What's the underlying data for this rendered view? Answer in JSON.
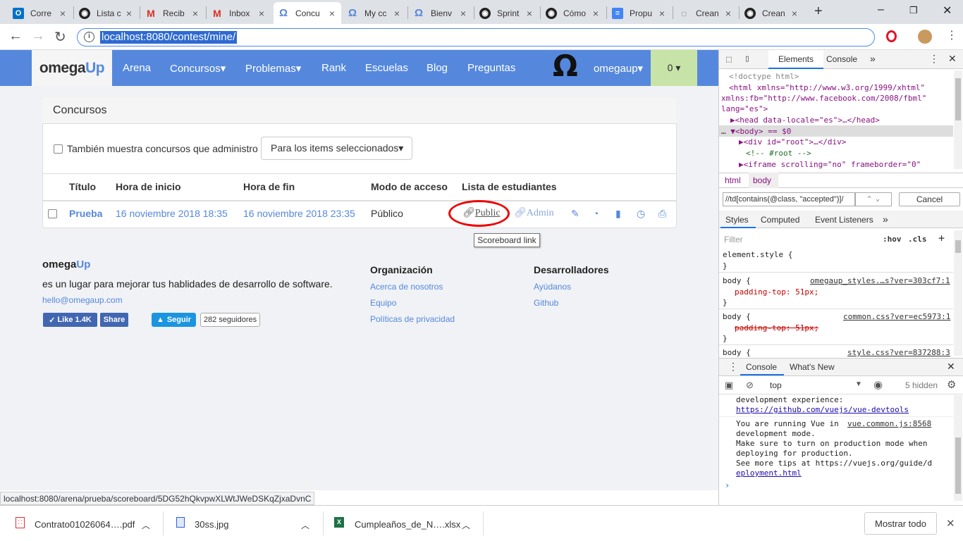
{
  "browser": {
    "tabs": [
      {
        "title": "Corre",
        "favicon": "outlook-icon",
        "color": "#0072c6"
      },
      {
        "title": "Lista c",
        "favicon": "github-icon",
        "color": "#222"
      },
      {
        "title": "Recib",
        "favicon": "gmail-icon",
        "color": "#d93025"
      },
      {
        "title": "Inbox",
        "favicon": "gmail-icon",
        "color": "#d93025"
      },
      {
        "title": "Concu",
        "favicon": "omegaup-icon",
        "color": "#5588dd",
        "active": true
      },
      {
        "title": "My cc",
        "favicon": "omegaup-icon",
        "color": "#5588dd"
      },
      {
        "title": "Bienv",
        "favicon": "omegaup-icon",
        "color": "#5588dd"
      },
      {
        "title": "Sprint",
        "favicon": "github-icon",
        "color": "#222"
      },
      {
        "title": "Cómo",
        "favicon": "github-icon",
        "color": "#222"
      },
      {
        "title": "Propu",
        "favicon": "docs-icon",
        "color": "#4285f4"
      },
      {
        "title": "Crean",
        "favicon": "loading-icon",
        "color": "#555"
      },
      {
        "title": "Crean",
        "favicon": "github-icon",
        "color": "#222"
      }
    ],
    "url": "localhost:8080/contest/mine/"
  },
  "navbar": {
    "logo_main": "omega",
    "logo_accent": "Up",
    "items": [
      "Arena",
      "Concursos▾",
      "Problemas▾",
      "Rank",
      "Escuelas",
      "Blog",
      "Preguntas"
    ],
    "user": "omegaup▾",
    "notifications": "0 ▾"
  },
  "panel": {
    "title": "Concursos",
    "checkbox_label": "También muestra concursos que administro",
    "bulk_button": "Para los items seleccionados▾",
    "columns": [
      "Título",
      "Hora de inicio",
      "Hora de fin",
      "Modo de acceso",
      "Lista de estudiantes"
    ],
    "row": {
      "title": "Prueba",
      "start": "16 noviembre 2018 18:35",
      "end": "16 noviembre 2018 23:35",
      "access": "Público",
      "public_link": "Public",
      "admin_link": "Admin"
    },
    "tooltip": "Scoreboard link"
  },
  "footer": {
    "logo_main": "omega",
    "logo_accent": "Up",
    "tagline": "es un lugar para mejorar tus hablidades de desarrollo de software.",
    "email": "hello@omegaup.com",
    "like": "Like 1.4K",
    "share": "Share",
    "follow": "Seguir",
    "followers": "282 seguidores",
    "org_title": "Organización",
    "org_links": [
      "Acerca de nosotros",
      "Equipo",
      "Políticas de privacidad"
    ],
    "dev_title": "Desarrolladores",
    "dev_links": [
      "Ayúdanos",
      "Github"
    ]
  },
  "statusbar": "localhost:8080/arena/prueba/scoreboard/5DG52hQkvpwXLWtJWeDSKqZjxaDvnC",
  "devtools": {
    "tabs": [
      "Elements",
      "Console"
    ],
    "dom": [
      "<!doctype html>",
      "<html xmlns=\"http://www.w3.org/1999/xhtml\"",
      "xmlns:fb=\"http://www.facebook.com/2008/fbml\"",
      "lang=\"es\">",
      "▶<head data-locale=\"es\">…</head>",
      "▼<body> == $0",
      "▶<div id=\"root\">…</div>",
      "<!-- #root -->",
      "▶<iframe scrolling=\"no\" frameborder=\"0\""
    ],
    "breadcrumbs": [
      "html",
      "body"
    ],
    "search_value": "//td[contains(@class, \"accepted\")]/",
    "cancel": "Cancel",
    "style_tabs": [
      "Styles",
      "Computed",
      "Event Listeners"
    ],
    "filter_placeholder": "Filter",
    "hov": ":hov",
    "cls": ".cls",
    "rules": [
      {
        "selector": "element.style {",
        "source": "",
        "prop": ""
      },
      {
        "selector": "body {",
        "source": "omegaup_styles.…s?ver=303cf7:1",
        "prop": "padding-top: 51px;"
      },
      {
        "selector": "body {",
        "source": "common.css?ver=ec5973:1",
        "prop": "padding-top: 51px;"
      },
      {
        "selector": "body {",
        "source": "style.css?ver=837288:3",
        "prop": ""
      }
    ],
    "drawer_tabs": [
      "Console",
      "What's New"
    ],
    "context": "top",
    "hidden": "5 hidden",
    "console": [
      "development experience:",
      "https://github.com/vuejs/vue-devtools",
      "You are running Vue in",
      "vue.common.js:8568",
      "development mode.",
      "Make sure to turn on production mode when",
      "deploying for production.",
      "See more tips at https://vuejs.org/guide/d",
      "eployment.html"
    ]
  },
  "downloads": {
    "items": [
      "Contrato01026064….pdf",
      "30ss.jpg",
      "Cumpleaños_de_N….xlsx"
    ],
    "show_all": "Mostrar todo"
  }
}
